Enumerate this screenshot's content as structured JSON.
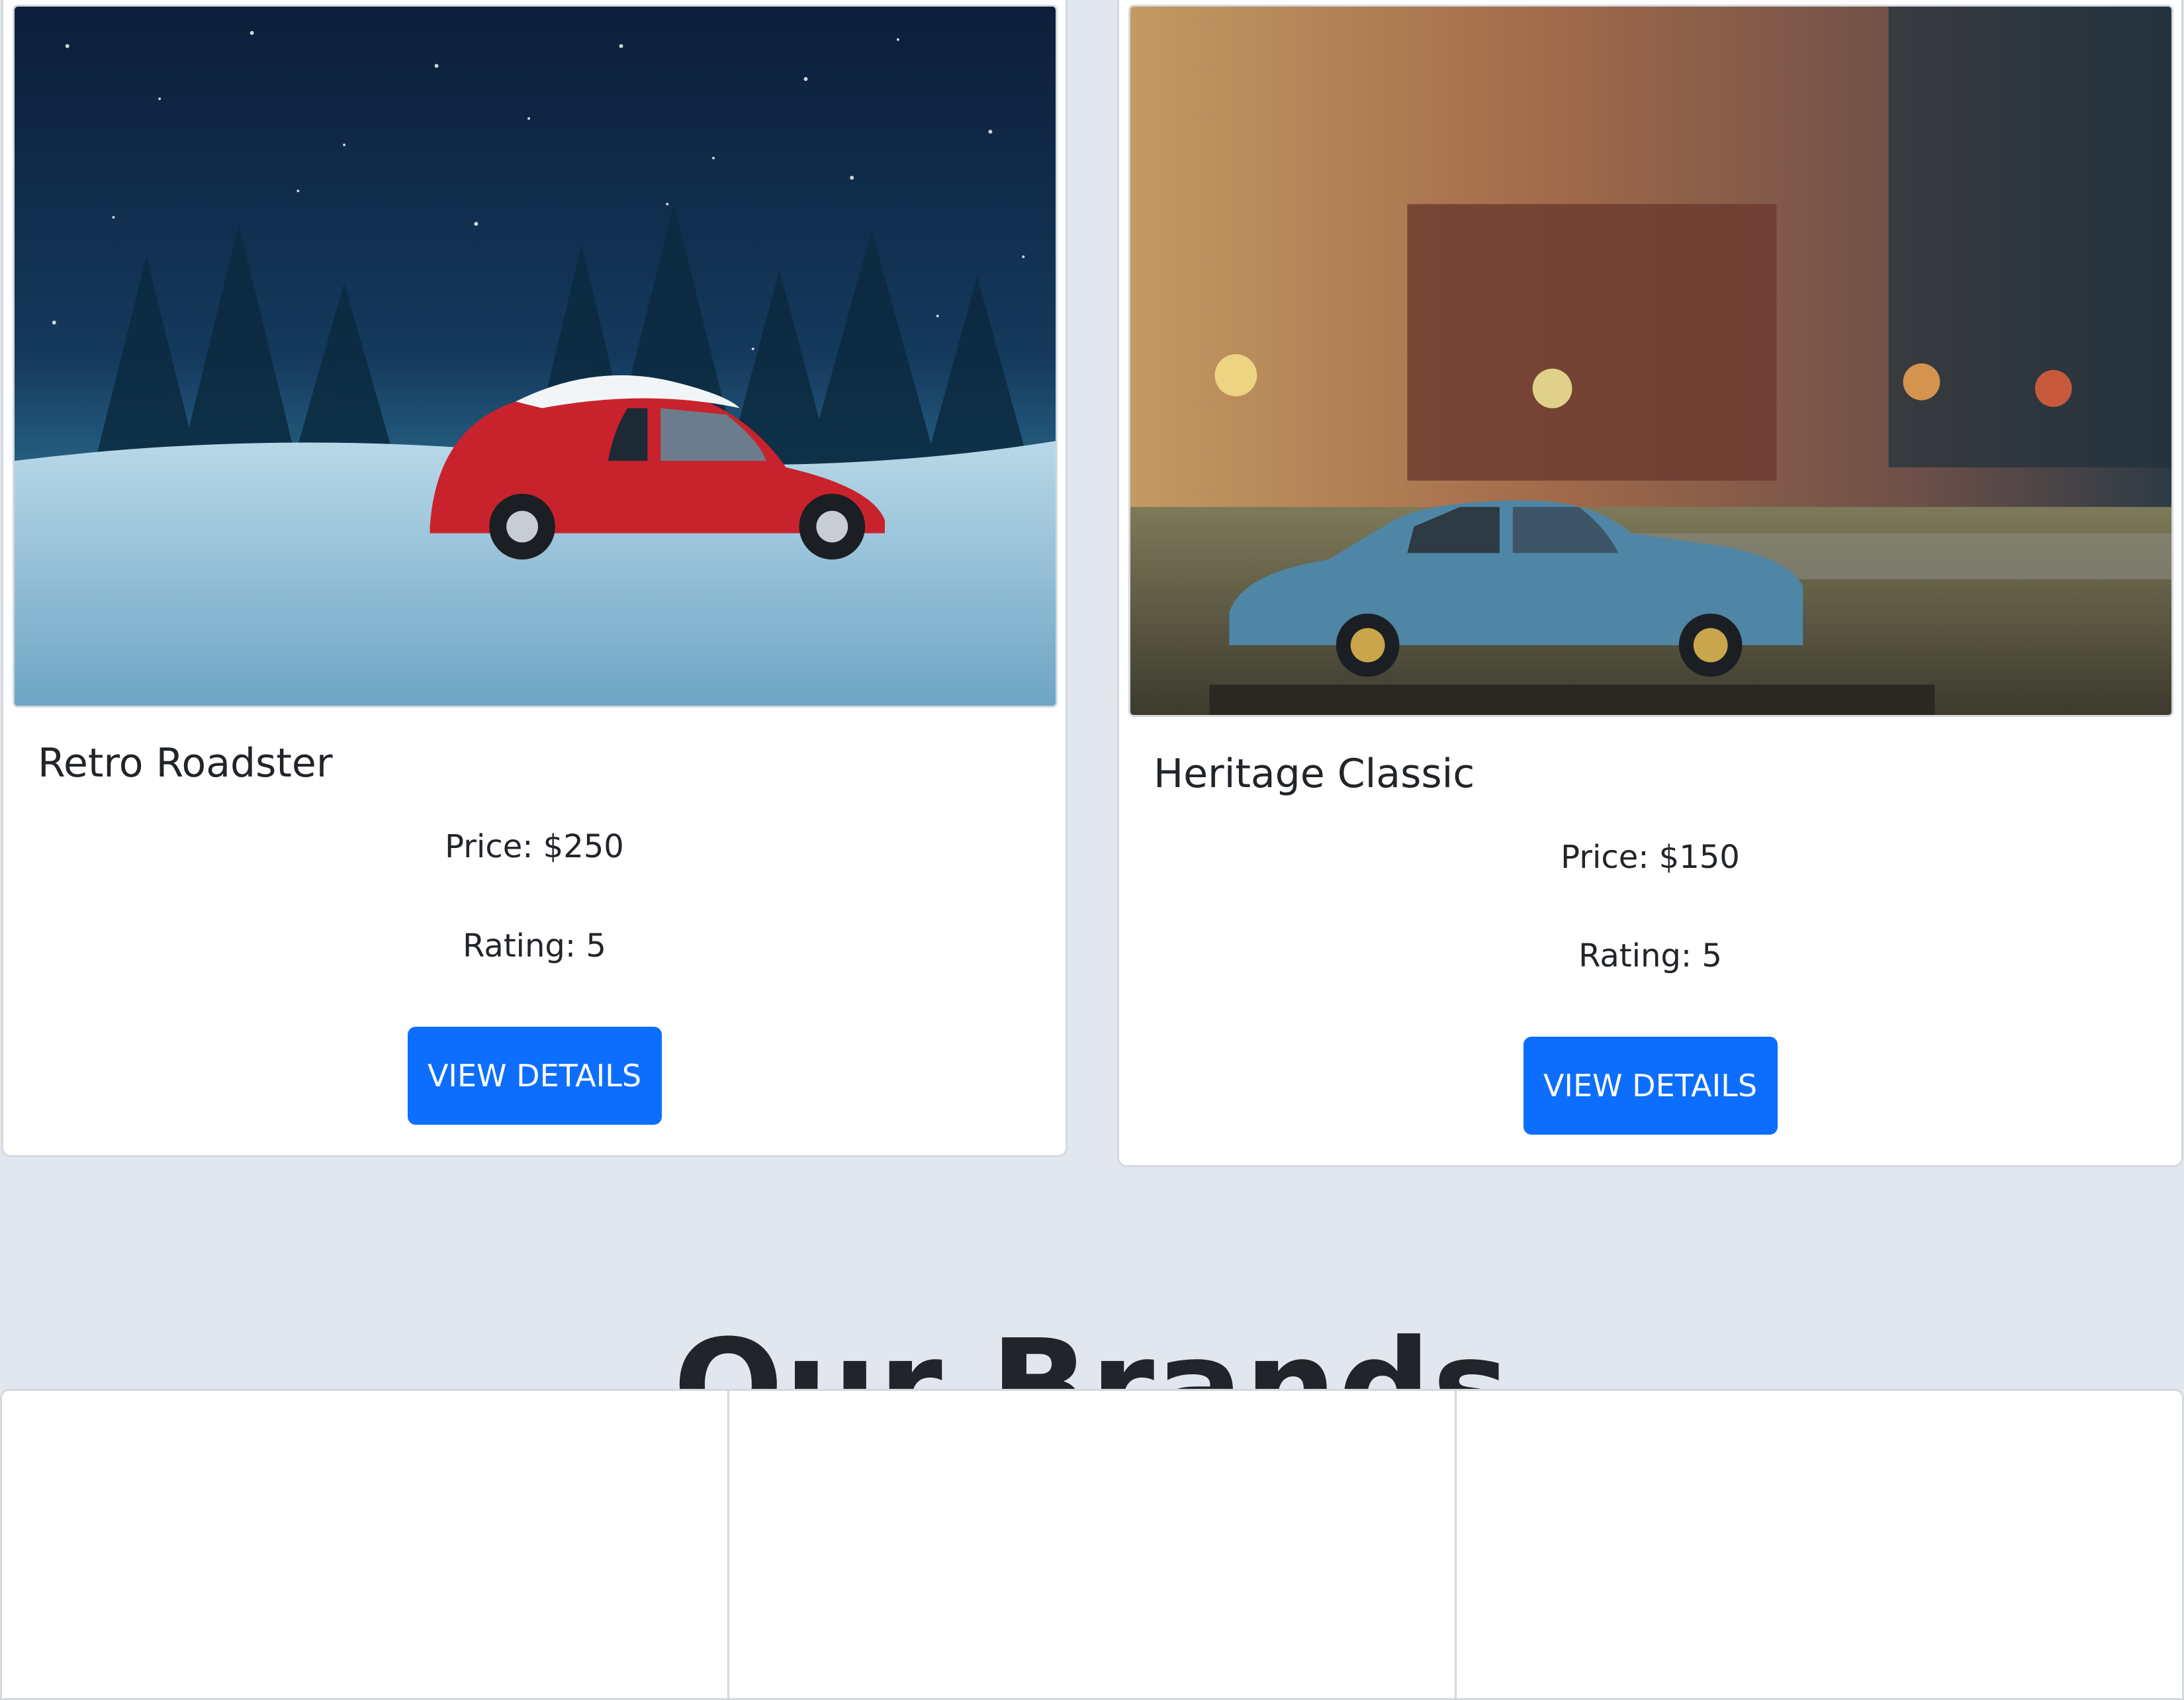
{
  "products": [
    {
      "title": "Retro Roadster",
      "price": "Price: $250",
      "rating": "Rating: 5",
      "button_label": "VIEW DETAILS",
      "image": "red vintage beetle car in snowy night forest"
    },
    {
      "title": "Heritage Classic",
      "price": "Price: $150",
      "rating": "Rating: 5",
      "button_label": "VIEW DETAILS",
      "image": "blue vintage sedan toy car with blurred autumn background"
    }
  ],
  "brands": {
    "title": "Our Brands",
    "items": 3
  },
  "colors": {
    "page_background": "#e2e7ef",
    "primary_button": "#0d6efd",
    "card_background": "#ffffff",
    "card_border": "#d5d8dd",
    "text": "#212529"
  }
}
